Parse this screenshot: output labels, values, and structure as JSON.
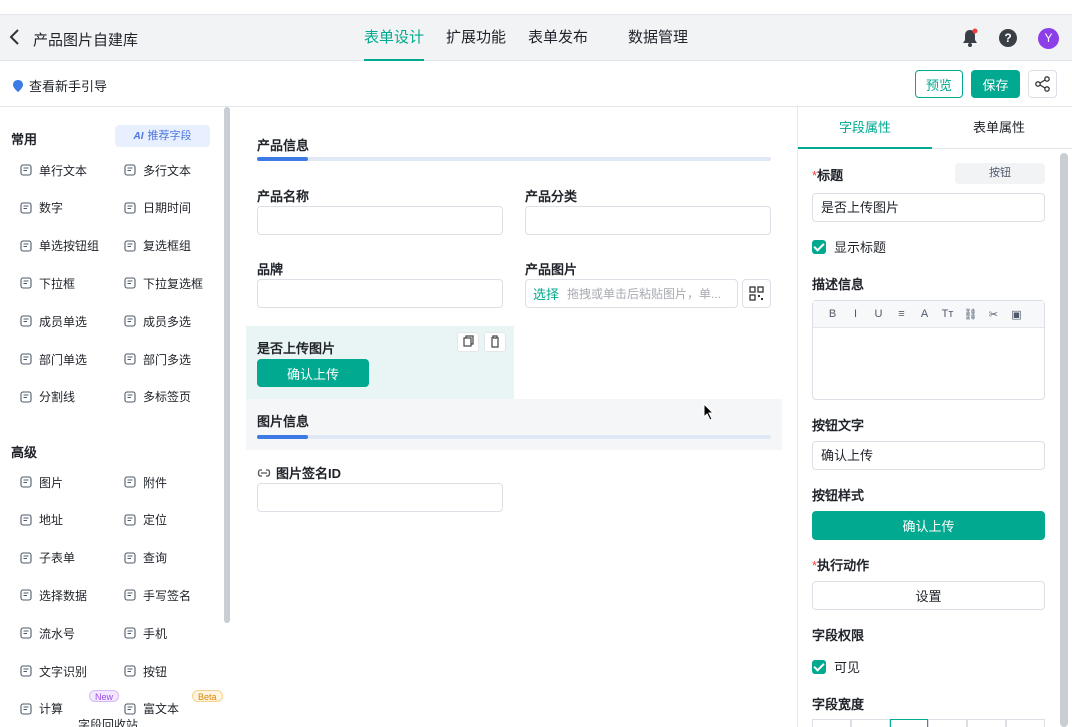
{
  "header": {
    "back_icon": "chevron-left-icon",
    "app_title": "产品图片自建库",
    "tabs": [
      "表单设计",
      "扩展功能",
      "表单发布",
      "数据管理"
    ],
    "active_tab": "表单设计",
    "avatar_letter": "Y",
    "help_glyph": "?"
  },
  "toolbar": {
    "guide_label": "查看新手引导",
    "preview_label": "预览",
    "save_label": "保存"
  },
  "palette": {
    "common_title": "常用",
    "ai_prefix": "AI",
    "ai_label": "推荐字段",
    "common_items": [
      "单行文本",
      "多行文本",
      "数字",
      "日期时间",
      "单选按钮组",
      "复选框组",
      "下拉框",
      "下拉复选框",
      "成员单选",
      "成员多选",
      "部门单选",
      "部门多选",
      "分割线",
      "多标签页"
    ],
    "advanced_title": "高级",
    "advanced_items": [
      "图片",
      "附件",
      "地址",
      "定位",
      "子表单",
      "查询",
      "选择数据",
      "手写签名",
      "流水号",
      "手机",
      "文字识别",
      "按钮",
      "计算",
      "富文本"
    ],
    "badge_new": "New",
    "badge_beta": "Beta",
    "bottom_text": "字段回收站"
  },
  "canvas": {
    "section1": "产品信息",
    "field_name": "产品名称",
    "field_category": "产品分类",
    "field_brand": "品牌",
    "field_image": "产品图片",
    "upload_select": "选择",
    "upload_hint": "拖拽或单击后粘贴图片，单...",
    "selected_field_label": "是否上传图片",
    "selected_button_text": "确认上传",
    "section2": "图片信息",
    "field_sign_id": "图片签名ID"
  },
  "panel": {
    "tabs": [
      "字段属性",
      "表单属性"
    ],
    "active_tab": "字段属性",
    "title_label": "标题",
    "title_type_btn": "按钮",
    "title_value": "是否上传图片",
    "show_title": "显示标题",
    "desc_label": "描述信息",
    "rte_tools": [
      "B",
      "I",
      "U",
      "≡",
      "A",
      "Tт",
      "⛓",
      "✂",
      "▣"
    ],
    "btn_text_label": "按钮文字",
    "btn_text_value": "确认上传",
    "btn_style_label": "按钮样式",
    "btn_style_preview": "确认上传",
    "action_label": "执行动作",
    "action_btn": "设置",
    "perm_label": "字段权限",
    "perm_visible": "可见",
    "width_label": "字段宽度"
  },
  "colors": {
    "accent": "#00a98f",
    "section_bar": "#3d7ae5",
    "avatar": "#8c3fe6",
    "selected_bg": "#e9f5f4"
  }
}
